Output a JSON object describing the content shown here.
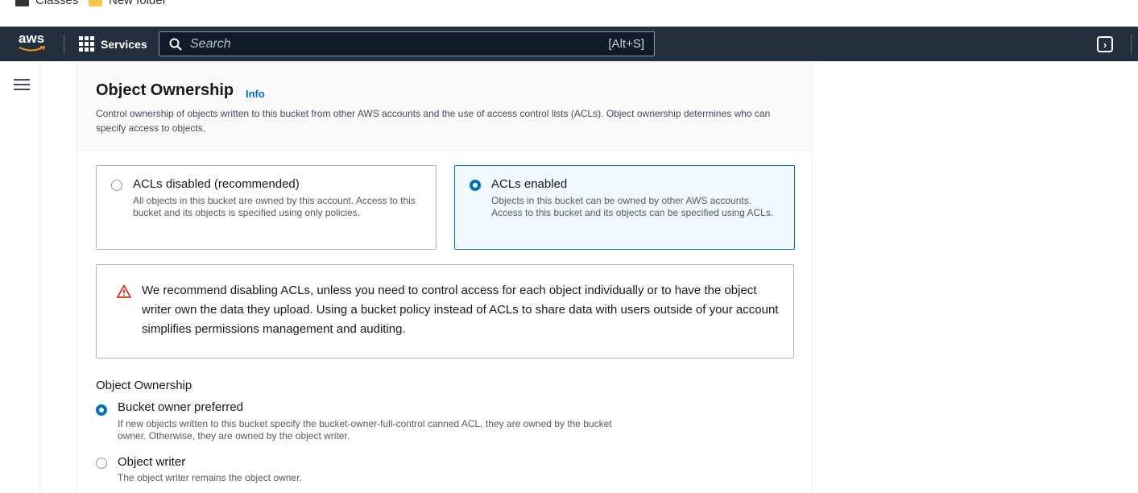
{
  "bookmarks": [
    {
      "label": "Classes",
      "icon": "classes-icon"
    },
    {
      "label": "New folder",
      "icon": "folder-icon"
    }
  ],
  "topnav": {
    "logo_text": "aws",
    "services_label": "Services",
    "search_placeholder": "Search",
    "search_shortcut": "[Alt+S]",
    "cloudshell_icon": "cloudshell-icon"
  },
  "section": {
    "title": "Object Ownership",
    "info_link": "Info",
    "description": "Control ownership of objects written to this bucket from other AWS accounts and the use of access control lists (ACLs). Object ownership determines who can specify access to objects."
  },
  "tiles": [
    {
      "label": "ACLs disabled (recommended)",
      "description": "All objects in this bucket are owned by this account. Access to this bucket and its objects is specified using only policies.",
      "selected": false
    },
    {
      "label": "ACLs enabled",
      "description": "Objects in this bucket can be owned by other AWS accounts. Access to this bucket and its objects can be specified using ACLs.",
      "selected": true
    }
  ],
  "warning": {
    "text": "We recommend disabling ACLs, unless you need to control access for each object individually or to have the object writer own the data they upload. Using a bucket policy instead of ACLs to share data with users outside of your account simplifies permissions management and auditing.",
    "color": "#d13212"
  },
  "ownership": {
    "label": "Object Ownership",
    "options": [
      {
        "label": "Bucket owner preferred",
        "description": "If new objects written to this bucket specify the bucket-owner-full-control canned ACL, they are owned by the bucket owner. Otherwise, they are owned by the object writer.",
        "selected": true
      },
      {
        "label": "Object writer",
        "description": "The object writer remains the object owner.",
        "selected": false
      }
    ]
  },
  "colors": {
    "nav_bg": "#232f3e",
    "accent": "#0073bb",
    "selected_tile_bg": "#f1faff"
  }
}
